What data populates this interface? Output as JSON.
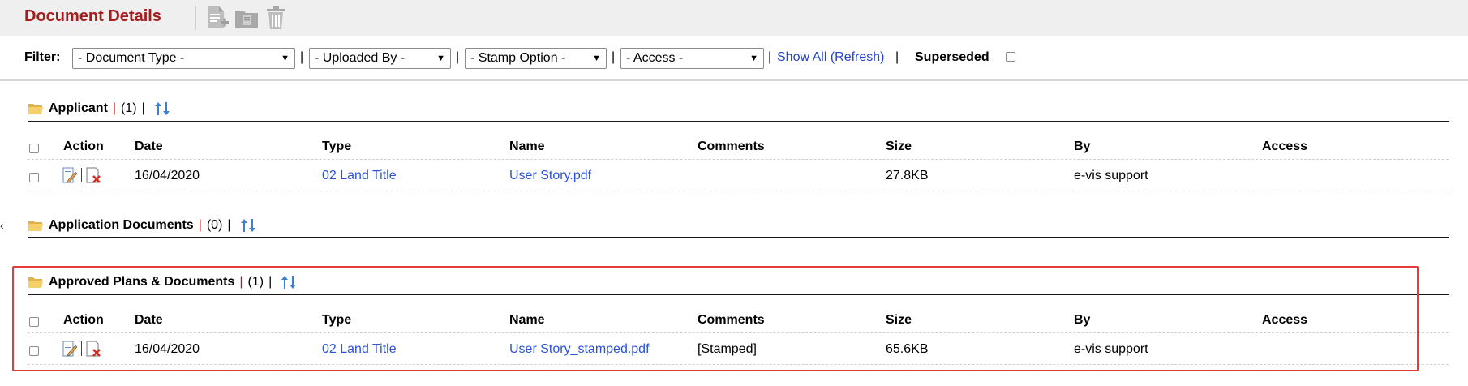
{
  "header": {
    "title": "Document Details",
    "icons": [
      "add-document-icon",
      "folder-document-icon",
      "trash-icon"
    ]
  },
  "filter": {
    "label": "Filter:",
    "selects": [
      {
        "value": "- Document Type -"
      },
      {
        "value": "- Uploaded By -"
      },
      {
        "value": "- Stamp Option -"
      },
      {
        "value": "- Access -"
      }
    ],
    "separator": "|",
    "show_all": "Show All (Refresh)",
    "superseded_label": "Superseded"
  },
  "columns": [
    "Action",
    "Date",
    "Type",
    "Name",
    "Comments",
    "Size",
    "By",
    "Access"
  ],
  "sections": [
    {
      "name": "Applicant",
      "count": "(1)",
      "rows": [
        {
          "date": "16/04/2020",
          "type": "02 Land Title",
          "name": "User Story.pdf",
          "comments": "",
          "size": "27.8KB",
          "by": "e-vis support",
          "access": ""
        }
      ]
    },
    {
      "name": "Application Documents",
      "count": "(0)",
      "rows": []
    },
    {
      "name": "Approved Plans & Documents",
      "count": "(1)",
      "rows": [
        {
          "date": "16/04/2020",
          "type": "02 Land Title",
          "name": "User Story_stamped.pdf",
          "comments": "[Stamped]",
          "size": "65.6KB",
          "by": "e-vis support",
          "access": ""
        }
      ]
    }
  ],
  "colors": {
    "title": "#a51c1c",
    "link": "#2d54d6",
    "highlight": "#e53b3b"
  }
}
